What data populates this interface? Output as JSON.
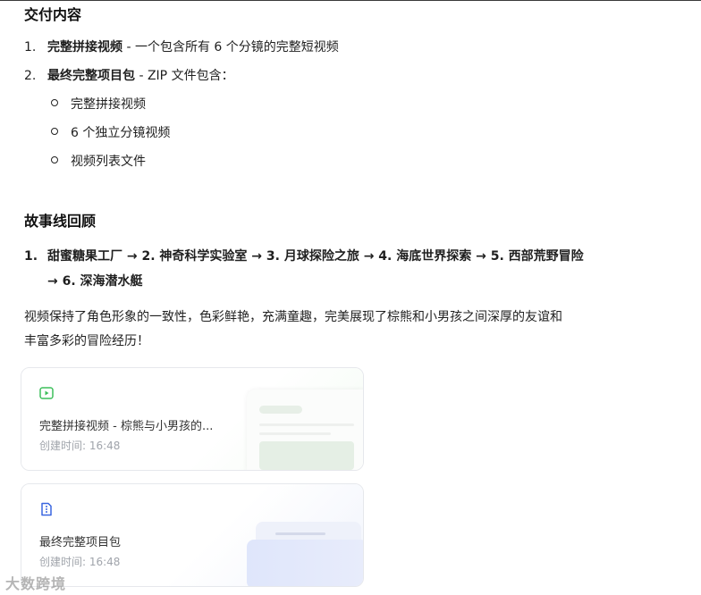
{
  "deliverables": {
    "heading": "交付内容",
    "items": [
      {
        "num": "1.",
        "title": "完整拼接视频",
        "desc": " - 一个包含所有 6 个分镜的完整短视频"
      },
      {
        "num": "2.",
        "title": "最终完整项目包",
        "desc": " - ZIP 文件包含："
      }
    ],
    "sub_items": [
      "完整拼接视频",
      "6 个独立分镜视频",
      "视频列表文件"
    ]
  },
  "storyline": {
    "heading": "故事线回顾",
    "num": "1.",
    "line1": "甜蜜糖果工厂 → 2. 神奇科学实验室 → 3. 月球探险之旅 → 4. 海底世界探索 → 5. 西部荒野冒险",
    "line2": "→ 6. 深海潜水艇"
  },
  "summary": {
    "line1": "视频保持了角色形象的一致性，色彩鲜艳，充满童趣，完美展现了棕熊和小男孩之间深厚的友谊和",
    "line2": "丰富多彩的冒险经历！"
  },
  "cards": [
    {
      "title": "完整拼接视频 - 棕熊与小男孩的...",
      "created": "创建时间: 16:48",
      "icon": "play-icon",
      "accent": "#3cbf5a"
    },
    {
      "title": "最终完整项目包",
      "created": "创建时间: 16:48",
      "icon": "package-icon",
      "accent": "#3a66e0"
    }
  ],
  "watermark": "大数跨境"
}
